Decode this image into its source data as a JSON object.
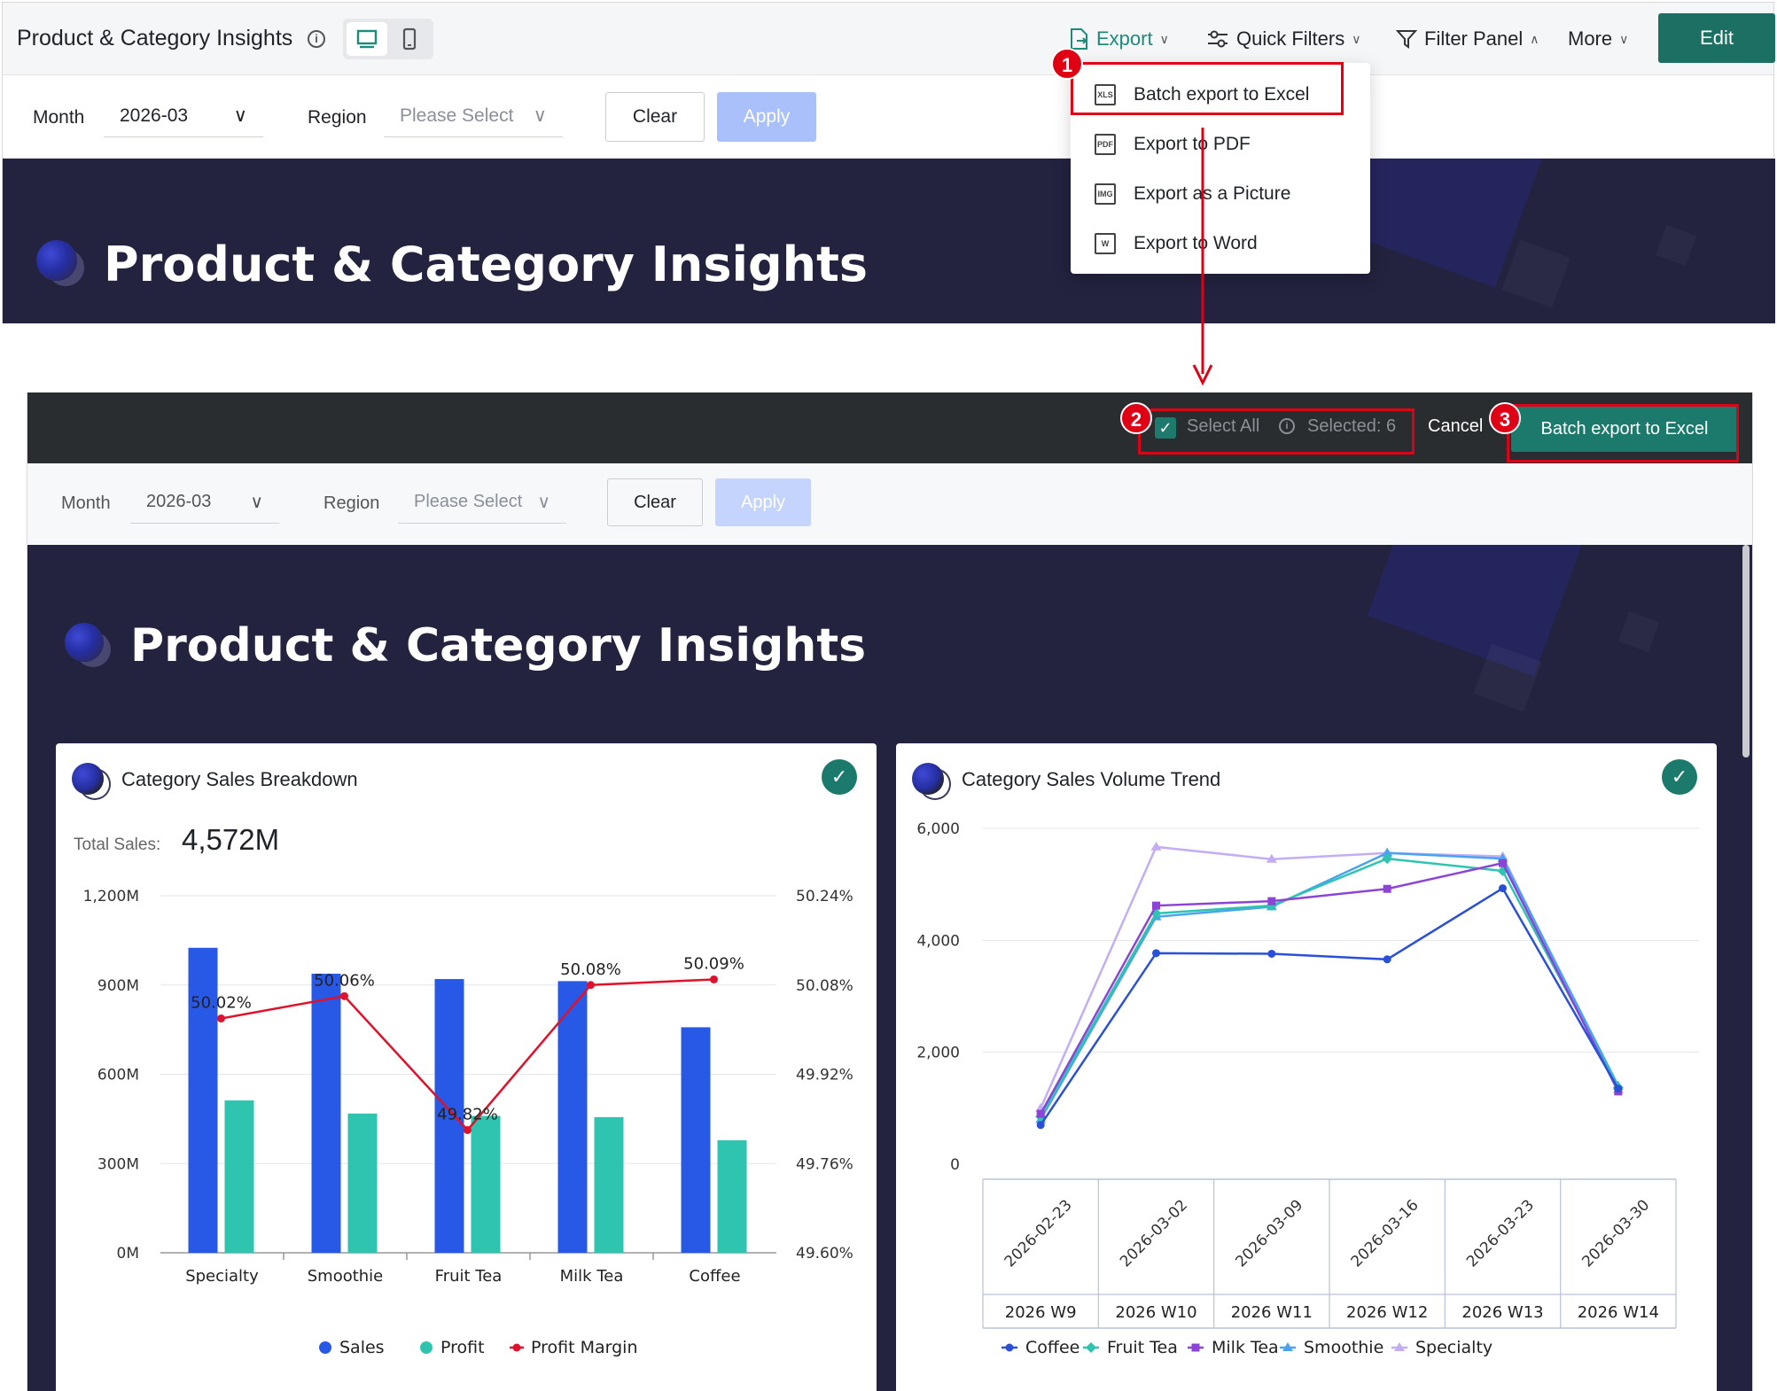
{
  "app": {
    "title": "Product & Category Insights",
    "actions": {
      "export": "Export",
      "quick_filters": "Quick Filters",
      "filter_panel": "Filter Panel",
      "more": "More",
      "edit": "Edit"
    }
  },
  "filters": {
    "month_label": "Month",
    "month_value": "2026-03",
    "region_label": "Region",
    "region_placeholder": "Please Select",
    "clear": "Clear",
    "apply": "Apply"
  },
  "banner": {
    "title": "Product & Category Insights"
  },
  "export_menu": [
    {
      "label": "Batch export to Excel",
      "icon": "xls-icon",
      "icon_text": "XLS"
    },
    {
      "label": "Export to PDF",
      "icon": "pdf-icon",
      "icon_text": "PDF"
    },
    {
      "label": "Export as a Picture",
      "icon": "picture-icon",
      "icon_text": "IMG"
    },
    {
      "label": "Export to Word",
      "icon": "word-icon",
      "icon_text": "W"
    }
  ],
  "annotations": {
    "step1": "1",
    "step2": "2",
    "step3": "3"
  },
  "selection_bar": {
    "select_all": "Select All",
    "selected": "Selected: 6",
    "cancel": "Cancel",
    "batch_export": "Batch export to Excel"
  },
  "colors": {
    "accent": "#1b7a6c",
    "annotation": "#e00016",
    "banner": "#23223f",
    "sales": "#2758e6",
    "profit": "#2ec4b0",
    "margin": "#e0112b"
  },
  "card_left": {
    "title": "Category Sales Breakdown",
    "total_label": "Total Sales:",
    "total_value": "4,572M"
  },
  "card_right": {
    "title": "Category Sales Volume Trend"
  },
  "chart_data": [
    {
      "type": "bar",
      "title": "Category Sales Breakdown",
      "categories": [
        "Specialty",
        "Smoothie",
        "Fruit Tea",
        "Milk Tea",
        "Coffee"
      ],
      "y_ticks": [
        "0M",
        "300M",
        "600M",
        "900M",
        "1,200M"
      ],
      "y2_ticks": [
        "49.60%",
        "49.76%",
        "49.92%",
        "50.08%",
        "50.24%"
      ],
      "ylim": [
        0,
        1200
      ],
      "y2lim": [
        49.6,
        50.24
      ],
      "series": [
        {
          "name": "Sales",
          "type": "bar",
          "color": "#2758e6",
          "values": [
            1025,
            938,
            920,
            913,
            758
          ]
        },
        {
          "name": "Profit",
          "type": "bar",
          "color": "#2ec4b0",
          "values": [
            512,
            468,
            460,
            456,
            378
          ]
        },
        {
          "name": "Profit Margin",
          "type": "line",
          "axis": "y2",
          "color": "#e0112b",
          "values": [
            50.02,
            50.06,
            49.82,
            50.08,
            50.09
          ],
          "labels": [
            "50.02%",
            "50.06%",
            "49.82%",
            "50.08%",
            "50.09%"
          ]
        }
      ],
      "legend": "bottom"
    },
    {
      "type": "line",
      "title": "Category Sales Volume Trend",
      "x": [
        "2026-02-23",
        "2026-03-02",
        "2026-03-09",
        "2026-03-16",
        "2026-03-23",
        "2026-03-30"
      ],
      "x_groups": [
        "2026 W9",
        "2026 W10",
        "2026 W11",
        "2026 W12",
        "2026 W13",
        "2026 W14"
      ],
      "y_ticks": [
        "0",
        "2,000",
        "4,000",
        "6,000"
      ],
      "ylim": [
        0,
        6000
      ],
      "series": [
        {
          "name": "Coffee",
          "color": "#2b50d8",
          "marker": "circle",
          "values": [
            700,
            3770,
            3760,
            3660,
            4930,
            1350
          ]
        },
        {
          "name": "Fruit Tea",
          "color": "#2ec4b0",
          "marker": "diamond",
          "values": [
            850,
            4480,
            4620,
            5460,
            5240,
            1370
          ]
        },
        {
          "name": "Milk Tea",
          "color": "#8b44d6",
          "marker": "square",
          "values": [
            900,
            4620,
            4700,
            4920,
            5380,
            1300
          ]
        },
        {
          "name": "Smoothie",
          "color": "#4aa3f0",
          "marker": "triangle",
          "values": [
            800,
            4420,
            4600,
            5560,
            5460,
            1400
          ]
        },
        {
          "name": "Specialty",
          "color": "#c3adf5",
          "marker": "triangle",
          "values": [
            1000,
            5670,
            5450,
            5560,
            5500,
            1330
          ]
        }
      ],
      "legend": "bottom"
    }
  ]
}
